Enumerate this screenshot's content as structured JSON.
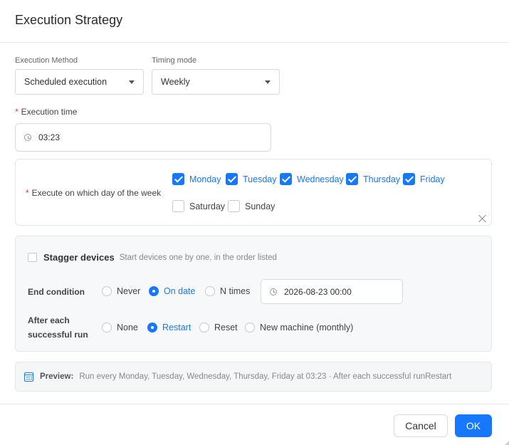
{
  "dialog": {
    "title": "Execution Strategy"
  },
  "execution_method": {
    "label": "Execution Method",
    "value": "Scheduled execution"
  },
  "timing_mode": {
    "label": "Timing mode",
    "value": "Weekly"
  },
  "execution_time": {
    "required_marker": "*",
    "label": "Execution time",
    "value": "03:23"
  },
  "weekdays": {
    "required_marker": "*",
    "label": "Execute on which day of the week",
    "days": [
      {
        "label": "Monday",
        "checked": true
      },
      {
        "label": "Tuesday",
        "checked": true
      },
      {
        "label": "Wednesday",
        "checked": true
      },
      {
        "label": "Thursday",
        "checked": true
      },
      {
        "label": "Friday",
        "checked": true
      },
      {
        "label": "Saturday",
        "checked": false
      },
      {
        "label": "Sunday",
        "checked": false
      }
    ]
  },
  "stagger": {
    "label": "Stagger devices",
    "description": "Start devices one by one, in the order listed",
    "checked": false
  },
  "end_condition": {
    "label": "End condition",
    "options": [
      {
        "label": "Never",
        "selected": false
      },
      {
        "label": "On date",
        "selected": true
      },
      {
        "label": "N times",
        "selected": false
      }
    ],
    "date_value": "2026-08-23 00:00"
  },
  "after_run": {
    "label_line1": "After each",
    "label_line2": "successful run",
    "options": [
      {
        "label": "None",
        "selected": false
      },
      {
        "label": "Restart",
        "selected": true
      },
      {
        "label": "Reset",
        "selected": false
      },
      {
        "label": "New machine (monthly)",
        "selected": false
      }
    ]
  },
  "preview": {
    "label": "Preview:",
    "text": "Run every Monday, Tuesday, Wednesday, Thursday, Friday at 03:23 · After each successful runRestart"
  },
  "footer": {
    "cancel_label": "Cancel",
    "ok_label": "OK"
  },
  "colors": {
    "accent": "#1677ff",
    "required": "#e33b3b"
  }
}
